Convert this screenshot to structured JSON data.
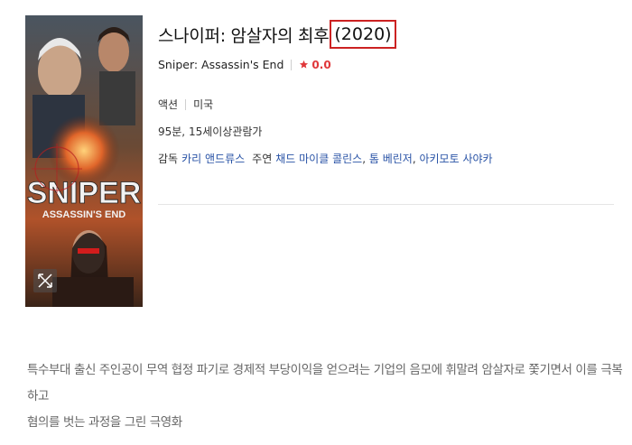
{
  "poster": {
    "title_line1": "SNIPER",
    "title_line2": "ASSASSIN'S END",
    "expand_icon": "expand-icon"
  },
  "movie": {
    "title_ko": "스나이퍼: 암살자의 최후",
    "year": "(2020)",
    "title_en": "Sniper: Assassin's End",
    "rating": "0.0",
    "genre": "액션",
    "country": "미국",
    "runtime_rating": "95분, 15세이상관람가",
    "director_label": "감독",
    "director": "카리 앤드류스",
    "cast_label": "주연",
    "cast": [
      "채드 마이클 콜린스",
      "톰 베린저",
      "아키모토 사야카"
    ]
  },
  "synopsis": {
    "line1": "특수부대 출신 주인공이 무역 협정 파기로 경제적 부당이익을 얻으려는 기업의 음모에 휘말려 암살자로 쫓기면서 이를 극복하고",
    "line2": "혐의를 벗는 과정을 그린 극영화"
  },
  "colors": {
    "accent_red": "#cc2222",
    "rating_red": "#e0383b",
    "link_blue": "#2953a6"
  }
}
